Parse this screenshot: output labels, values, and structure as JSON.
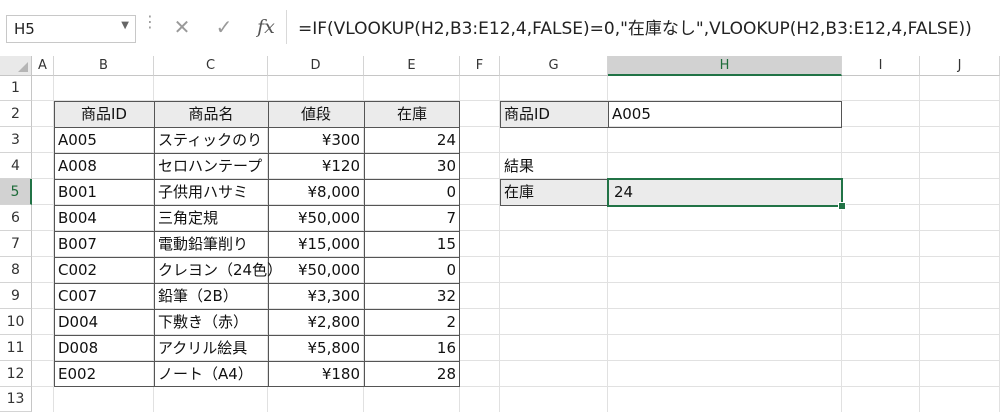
{
  "formula_bar": {
    "name_box": "H5",
    "name_box_arrow": "▼",
    "dots": "⋮",
    "cancel_icon": "✕",
    "confirm_icon": "✓",
    "fx_label": "fx",
    "formula": "=IF(VLOOKUP(H2,B3:E12,4,FALSE)=0,\"在庫なし\",VLOOKUP(H2,B3:E12,4,FALSE))"
  },
  "columns": [
    "A",
    "B",
    "C",
    "D",
    "E",
    "F",
    "G",
    "H",
    "I",
    "J"
  ],
  "selected_column": "H",
  "rows": [
    "1",
    "2",
    "3",
    "4",
    "5",
    "6",
    "7",
    "8",
    "9",
    "10",
    "11",
    "12",
    "13"
  ],
  "selected_row": "5",
  "table": {
    "headers": [
      "商品ID",
      "商品名",
      "値段",
      "在庫"
    ],
    "rows": [
      [
        "A005",
        "スティックのり",
        "¥300",
        "24"
      ],
      [
        "A008",
        "セロハンテープ",
        "¥120",
        "30"
      ],
      [
        "B001",
        "子供用ハサミ",
        "¥8,000",
        "0"
      ],
      [
        "B004",
        "三角定規",
        "¥50,000",
        "7"
      ],
      [
        "B007",
        "電動鉛筆削り",
        "¥15,000",
        "15"
      ],
      [
        "C002",
        "クレヨン（24色）",
        "¥50,000",
        "0"
      ],
      [
        "C007",
        "鉛筆（2B）",
        "¥3,300",
        "32"
      ],
      [
        "D004",
        "下敷き（赤）",
        "¥2,800",
        "2"
      ],
      [
        "D008",
        "アクリル絵具",
        "¥5,800",
        "16"
      ],
      [
        "E002",
        "ノート（A4）",
        "¥180",
        "28"
      ]
    ]
  },
  "lookup": {
    "id_label": "商品ID",
    "id_value": "A005",
    "result_heading": "結果",
    "result_label": "在庫",
    "result_value": "24"
  },
  "colors": {
    "accent": "#217346",
    "header_fill": "#ebebeb",
    "border": "#555555"
  }
}
